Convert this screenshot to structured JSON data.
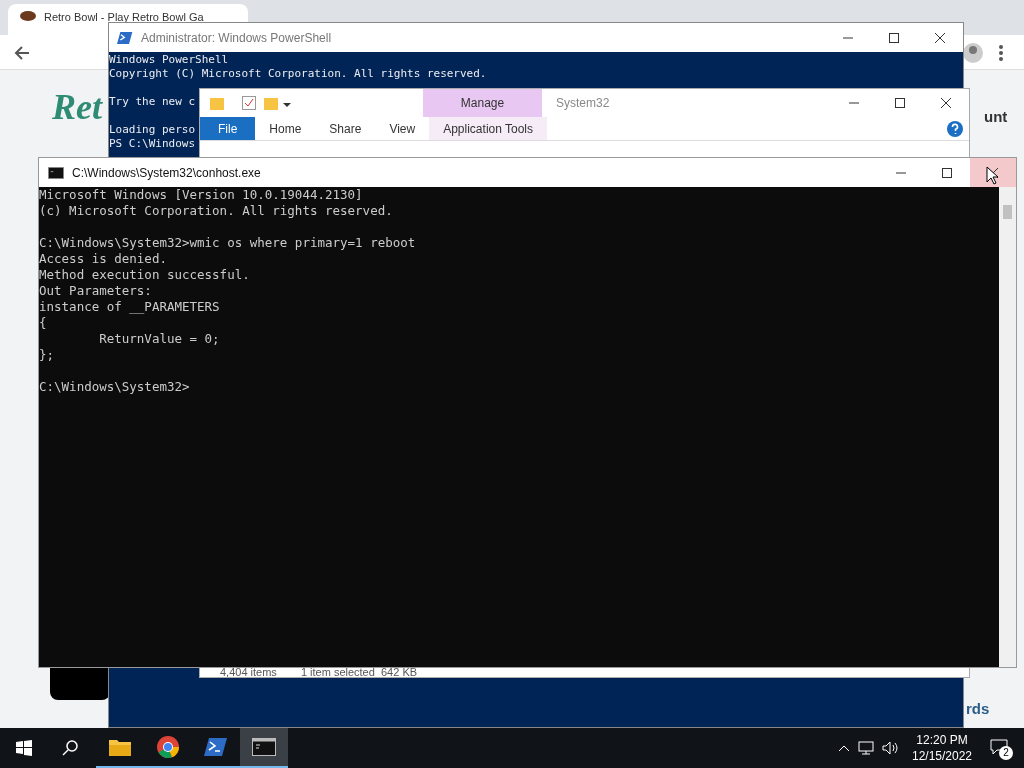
{
  "browser": {
    "tab_title": "Retro Bowl - Play Retro Bowl Ga",
    "logo_text": "Ret",
    "account_text": "unt",
    "footer_text": "rds"
  },
  "powershell": {
    "title": "Administrator: Windows PowerShell",
    "blocks": [
      [
        "Windows PowerShell",
        "Copyright (C) Microsoft Corporation. All rights reserved."
      ],
      [
        "Try the new c"
      ],
      [
        "Loading perso",
        "PS C:\\Windows"
      ]
    ]
  },
  "explorer": {
    "title": "System32",
    "context_tab": "Manage",
    "ribbon_tabs": [
      {
        "label": "File",
        "kind": "file"
      },
      {
        "label": "Home",
        "kind": "tab"
      },
      {
        "label": "Share",
        "kind": "tab"
      },
      {
        "label": "View",
        "kind": "tab"
      },
      {
        "label": "Application Tools",
        "kind": "context"
      }
    ],
    "status": [
      "4,404 items",
      "1 item selected  642 KB"
    ]
  },
  "console": {
    "title": "C:\\Windows\\System32\\conhost.exe",
    "close_hovered": true,
    "blocks": [
      [
        "Microsoft Windows [Version 10.0.19044.2130]",
        "(c) Microsoft Corporation. All rights reserved."
      ],
      [
        "C:\\Windows\\System32>wmic os where primary=1 reboot",
        "Access is denied.",
        "Method execution successful.",
        "Out Parameters:",
        "instance of __PARAMETERS",
        "{",
        "        ReturnValue = 0;",
        "};"
      ],
      [
        "C:\\Windows\\System32>"
      ]
    ]
  },
  "taskbar": {
    "apps": [
      {
        "kind": "explorer",
        "selected": false
      },
      {
        "kind": "chrome",
        "selected": false
      },
      {
        "kind": "powershell",
        "selected": false
      },
      {
        "kind": "console",
        "selected": true
      }
    ],
    "time": "12:20 PM",
    "date": "12/15/2022",
    "notifications": "2"
  }
}
